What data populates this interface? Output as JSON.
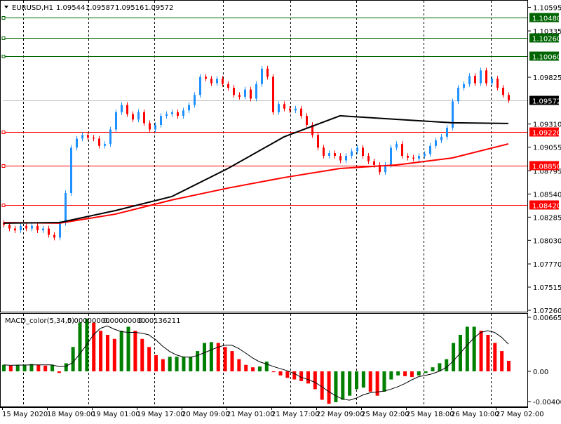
{
  "header": {
    "symbol": "EURUSD,H1",
    "open": "1.09544",
    "high": "1.09587",
    "low": "1.09516",
    "close": "1.09572"
  },
  "macd_header": {
    "name": "MACD_color(5,34,5)",
    "v1": "0.00000000",
    "v2": "0.00000000",
    "v3": "0.00136211"
  },
  "colors": {
    "bull": "#1e90ff",
    "bear": "#ff0000",
    "ma_fast": "#000000",
    "ma_slow": "#ff0000",
    "macd_up": "#008000",
    "macd_down": "#ff0000",
    "level_green": "#006400",
    "level_red": "#ff0000"
  },
  "chart_data": [
    {
      "type": "candlestick",
      "title": "EURUSD,H1",
      "ylim": [
        1.0726,
        1.1064
      ],
      "y_ticks": [
        "1.10595",
        "1.10335",
        "1.09825",
        "1.09310",
        "1.09055",
        "1.08795",
        "1.08540",
        "1.08285",
        "1.08030",
        "1.07770",
        "1.07515",
        "1.07260"
      ],
      "x_ticks": [
        "15 May 2020",
        "18 May 09:00",
        "19 May 01:00",
        "19 May 17:00",
        "20 May 09:00",
        "21 May 01:00",
        "21 May 17:00",
        "22 May 09:00",
        "25 May 02:00",
        "25 May 18:00",
        "26 May 10:00",
        "27 May 02:00"
      ],
      "grid": "vertical dashed",
      "closes": [
        1.082,
        1.0816,
        1.0814,
        1.0819,
        1.0816,
        1.0819,
        1.0814,
        1.0816,
        1.0809,
        1.0806,
        1.0822,
        1.0855,
        1.0905,
        1.0915,
        1.0919,
        1.0916,
        1.0915,
        1.0907,
        1.0909,
        1.0925,
        1.0944,
        1.0952,
        1.0942,
        1.0936,
        1.0944,
        1.0932,
        1.0925,
        1.093,
        1.094,
        1.0942,
        1.0944,
        1.094,
        1.0946,
        1.0952,
        1.0963,
        1.0983,
        1.0981,
        1.0976,
        1.0981,
        1.0975,
        1.0971,
        1.0963,
        1.0961,
        1.0969,
        1.0959,
        1.0975,
        1.0992,
        1.0983,
        1.0944,
        1.0953,
        1.0948,
        1.0946,
        1.0948,
        1.094,
        1.093,
        1.0919,
        1.0905,
        1.0896,
        1.0899,
        1.0896,
        1.0891,
        1.0896,
        1.0901,
        1.0905,
        1.0896,
        1.089,
        1.0886,
        1.0878,
        1.0886,
        1.0905,
        1.0909,
        1.0896,
        1.0894,
        1.0893,
        1.0896,
        1.0898,
        1.0907,
        1.0913,
        1.0917,
        1.0927,
        1.0956,
        1.0971,
        1.0975,
        1.0984,
        1.0976,
        1.099,
        1.0976,
        1.0981,
        1.0971,
        1.0963,
        1.09572
      ],
      "ma_fast": [
        1.08219,
        1.08226,
        1.08358,
        1.08512,
        1.08821,
        1.09169,
        1.09401,
        1.09362,
        1.09324,
        1.09316
      ],
      "ma_slow": [
        1.08226,
        1.08219,
        1.08319,
        1.08474,
        1.08605,
        1.08721,
        1.08821,
        1.0886,
        1.08937,
        1.09092
      ],
      "levels": [
        {
          "value": 1.1048,
          "label": "1.10480",
          "color": "green"
        },
        {
          "value": 1.1026,
          "label": "1.10260",
          "color": "green"
        },
        {
          "value": 1.1006,
          "label": "1.10060",
          "color": "green"
        },
        {
          "value": 1.09572,
          "label": "1.09572",
          "color": "current"
        },
        {
          "value": 1.0922,
          "label": "1.09220",
          "color": "red"
        },
        {
          "value": 1.0885,
          "label": "1.08850",
          "color": "red"
        },
        {
          "value": 1.0842,
          "label": "1.08420",
          "color": "red"
        }
      ]
    },
    {
      "type": "bar",
      "title": "MACD_color(5,34,5)",
      "ylim": [
        -0.0040043,
        0.0066558
      ],
      "y_ticks": [
        "0.0066558",
        "0.00",
        "-0.0040043"
      ],
      "values": [
        0.0008,
        0.0007,
        0.0008,
        0.0008,
        0.0009,
        0.0008,
        0.0007,
        0.0008,
        -0.0002,
        0.001,
        0.003,
        0.006,
        0.0065,
        0.006,
        0.005,
        0.0045,
        0.004,
        0.005,
        0.0055,
        0.005,
        0.004,
        0.003,
        0.002,
        0.0015,
        0.0018,
        0.0018,
        0.0018,
        0.0018,
        0.0025,
        0.0035,
        0.0036,
        0.0035,
        0.003,
        0.0025,
        0.0015,
        0.0008,
        0.0005,
        0.0006,
        0.0012,
        -0.0001,
        -0.0005,
        -0.0008,
        -0.001,
        -0.0012,
        -0.0015,
        -0.0022,
        -0.0035,
        -0.004,
        -0.0038,
        -0.0035,
        -0.003,
        -0.0022,
        -0.002,
        -0.0025,
        -0.003,
        -0.0025,
        -0.001,
        -0.0005,
        -0.0006,
        -0.0007,
        -0.0005,
        -0.0002,
        0.0005,
        0.001,
        0.0015,
        0.0035,
        0.0045,
        0.0055,
        0.0055,
        0.005,
        0.0045,
        0.0035,
        0.0025,
        0.0013
      ]
    }
  ]
}
